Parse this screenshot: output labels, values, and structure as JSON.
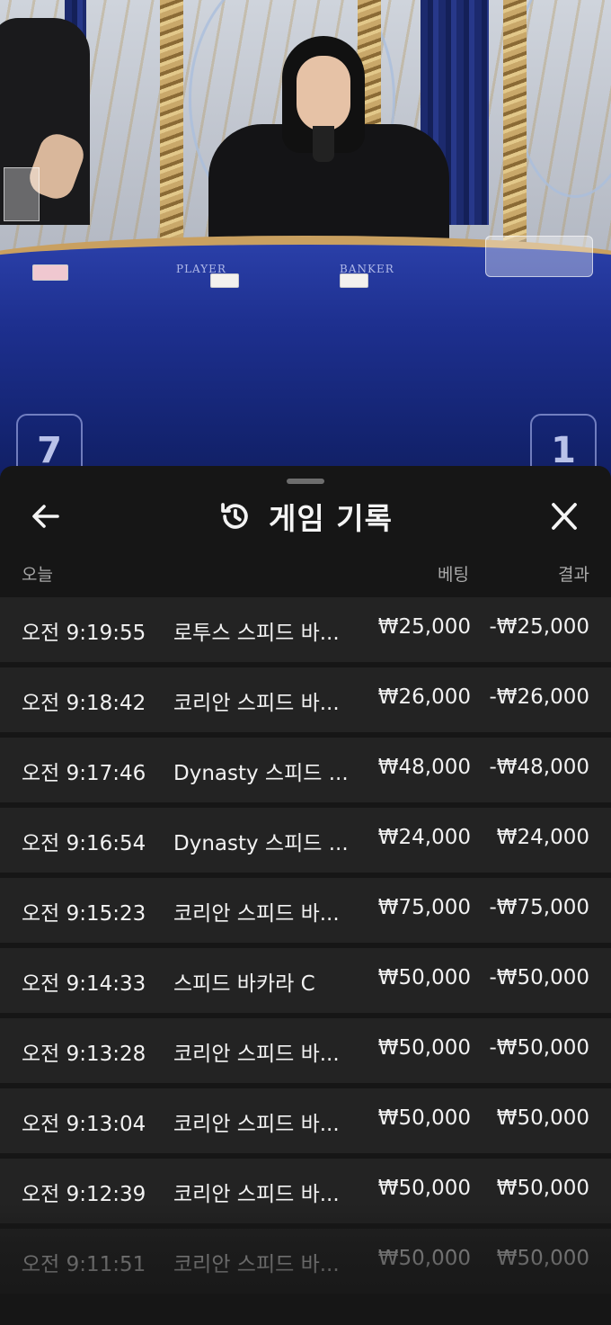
{
  "video": {
    "player_label": "PLAYER",
    "banker_label": "BANKER",
    "left_digit": "7",
    "right_digit": "1"
  },
  "sheet": {
    "title": "게임 기록",
    "icons": {
      "back": "arrow-left-icon",
      "history": "history-icon",
      "close": "close-icon"
    },
    "columns": {
      "day": "오늘",
      "bet": "베팅",
      "result": "결과"
    },
    "rows": [
      {
        "time": "오전 9:19:55",
        "game": "로투스 스피드 바...",
        "bet": "₩25,000",
        "result": "-₩25,000"
      },
      {
        "time": "오전 9:18:42",
        "game": "코리안 스피드 바...",
        "bet": "₩26,000",
        "result": "-₩26,000"
      },
      {
        "time": "오전 9:17:46",
        "game": "Dynasty 스피드 ...",
        "bet": "₩48,000",
        "result": "-₩48,000"
      },
      {
        "time": "오전 9:16:54",
        "game": "Dynasty 스피드 ...",
        "bet": "₩24,000",
        "result": "₩24,000"
      },
      {
        "time": "오전 9:15:23",
        "game": "코리안 스피드 바...",
        "bet": "₩75,000",
        "result": "-₩75,000"
      },
      {
        "time": "오전 9:14:33",
        "game": "스피드 바카라 C",
        "bet": "₩50,000",
        "result": "-₩50,000"
      },
      {
        "time": "오전 9:13:28",
        "game": "코리안 스피드 바...",
        "bet": "₩50,000",
        "result": "-₩50,000"
      },
      {
        "time": "오전 9:13:04",
        "game": "코리안 스피드 바...",
        "bet": "₩50,000",
        "result": "₩50,000"
      },
      {
        "time": "오전 9:12:39",
        "game": "코리안 스피드 바...",
        "bet": "₩50,000",
        "result": "₩50,000"
      },
      {
        "time": "오전 9:11:51",
        "game": "코리안 스피드 바...",
        "bet": "₩50,000",
        "result": "₩50,000"
      }
    ]
  }
}
